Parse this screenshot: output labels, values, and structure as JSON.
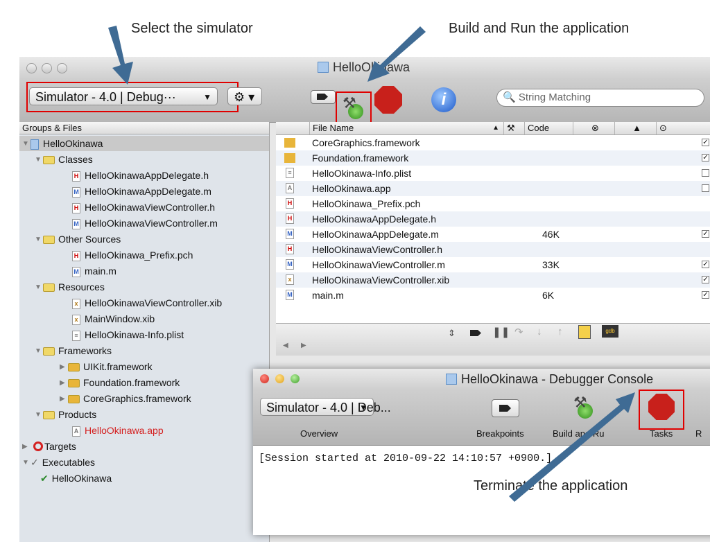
{
  "annotations": {
    "select_simulator": "Select the simulator",
    "build_and_run": "Build and Run the application",
    "terminate": "Terminate the application"
  },
  "colors": {
    "arrow": "#3f6b94",
    "highlight": "#e00000"
  },
  "main_window": {
    "title": "HelloOkinawa",
    "scheme_popup": "Simulator - 4.0 | Debug···",
    "search_placeholder": "String Matching",
    "toolbar_icons": [
      "breakpoint-icon",
      "build-and-run-icon",
      "stop-icon",
      "info-icon",
      "gear-icon"
    ]
  },
  "sidebar": {
    "header": "Groups & Files",
    "items": [
      {
        "label": "HelloOkinawa"
      },
      {
        "label": "Classes"
      },
      {
        "label": "HelloOkinawaAppDelegate.h"
      },
      {
        "label": "HelloOkinawaAppDelegate.m"
      },
      {
        "label": "HelloOkinawaViewController.h"
      },
      {
        "label": "HelloOkinawaViewController.m"
      },
      {
        "label": "Other Sources"
      },
      {
        "label": "HelloOkinawa_Prefix.pch"
      },
      {
        "label": "main.m"
      },
      {
        "label": "Resources"
      },
      {
        "label": "HelloOkinawaViewController.xib"
      },
      {
        "label": "MainWindow.xib"
      },
      {
        "label": "HelloOkinawa-Info.plist"
      },
      {
        "label": "Frameworks"
      },
      {
        "label": "UIKit.framework"
      },
      {
        "label": "Foundation.framework"
      },
      {
        "label": "CoreGraphics.framework"
      },
      {
        "label": "Products"
      },
      {
        "label": "HelloOkinawa.app"
      },
      {
        "label": "Targets"
      },
      {
        "label": "Executables"
      },
      {
        "label": "HelloOkinawa"
      }
    ]
  },
  "file_table": {
    "columns": [
      "File Name",
      "Code"
    ],
    "rows": [
      {
        "name": "CoreGraphics.framework",
        "code": "",
        "checked": true
      },
      {
        "name": "Foundation.framework",
        "code": "",
        "checked": true
      },
      {
        "name": "HelloOkinawa-Info.plist",
        "code": "",
        "checked": false
      },
      {
        "name": "HelloOkinawa.app",
        "code": "",
        "checked": false
      },
      {
        "name": "HelloOkinawa_Prefix.pch",
        "code": "",
        "checked": null
      },
      {
        "name": "HelloOkinawaAppDelegate.h",
        "code": "",
        "checked": null
      },
      {
        "name": "HelloOkinawaAppDelegate.m",
        "code": "46K",
        "checked": true
      },
      {
        "name": "HelloOkinawaViewController.h",
        "code": "",
        "checked": null
      },
      {
        "name": "HelloOkinawaViewController.m",
        "code": "33K",
        "checked": true
      },
      {
        "name": "HelloOkinawaViewController.xib",
        "code": "",
        "checked": true
      },
      {
        "name": "main.m",
        "code": "6K",
        "checked": true
      }
    ]
  },
  "console_window": {
    "title": "HelloOkinawa - Debugger Console",
    "scheme_popup": "Simulator - 4.0 | Deb...",
    "labels": {
      "overview": "Overview",
      "breakpoints": "Breakpoints",
      "build_and_run": "Build and Ru",
      "tasks": "Tasks",
      "cut": "R"
    },
    "log": "[Session started at 2010-09-22 14:10:57 +0900.]"
  }
}
